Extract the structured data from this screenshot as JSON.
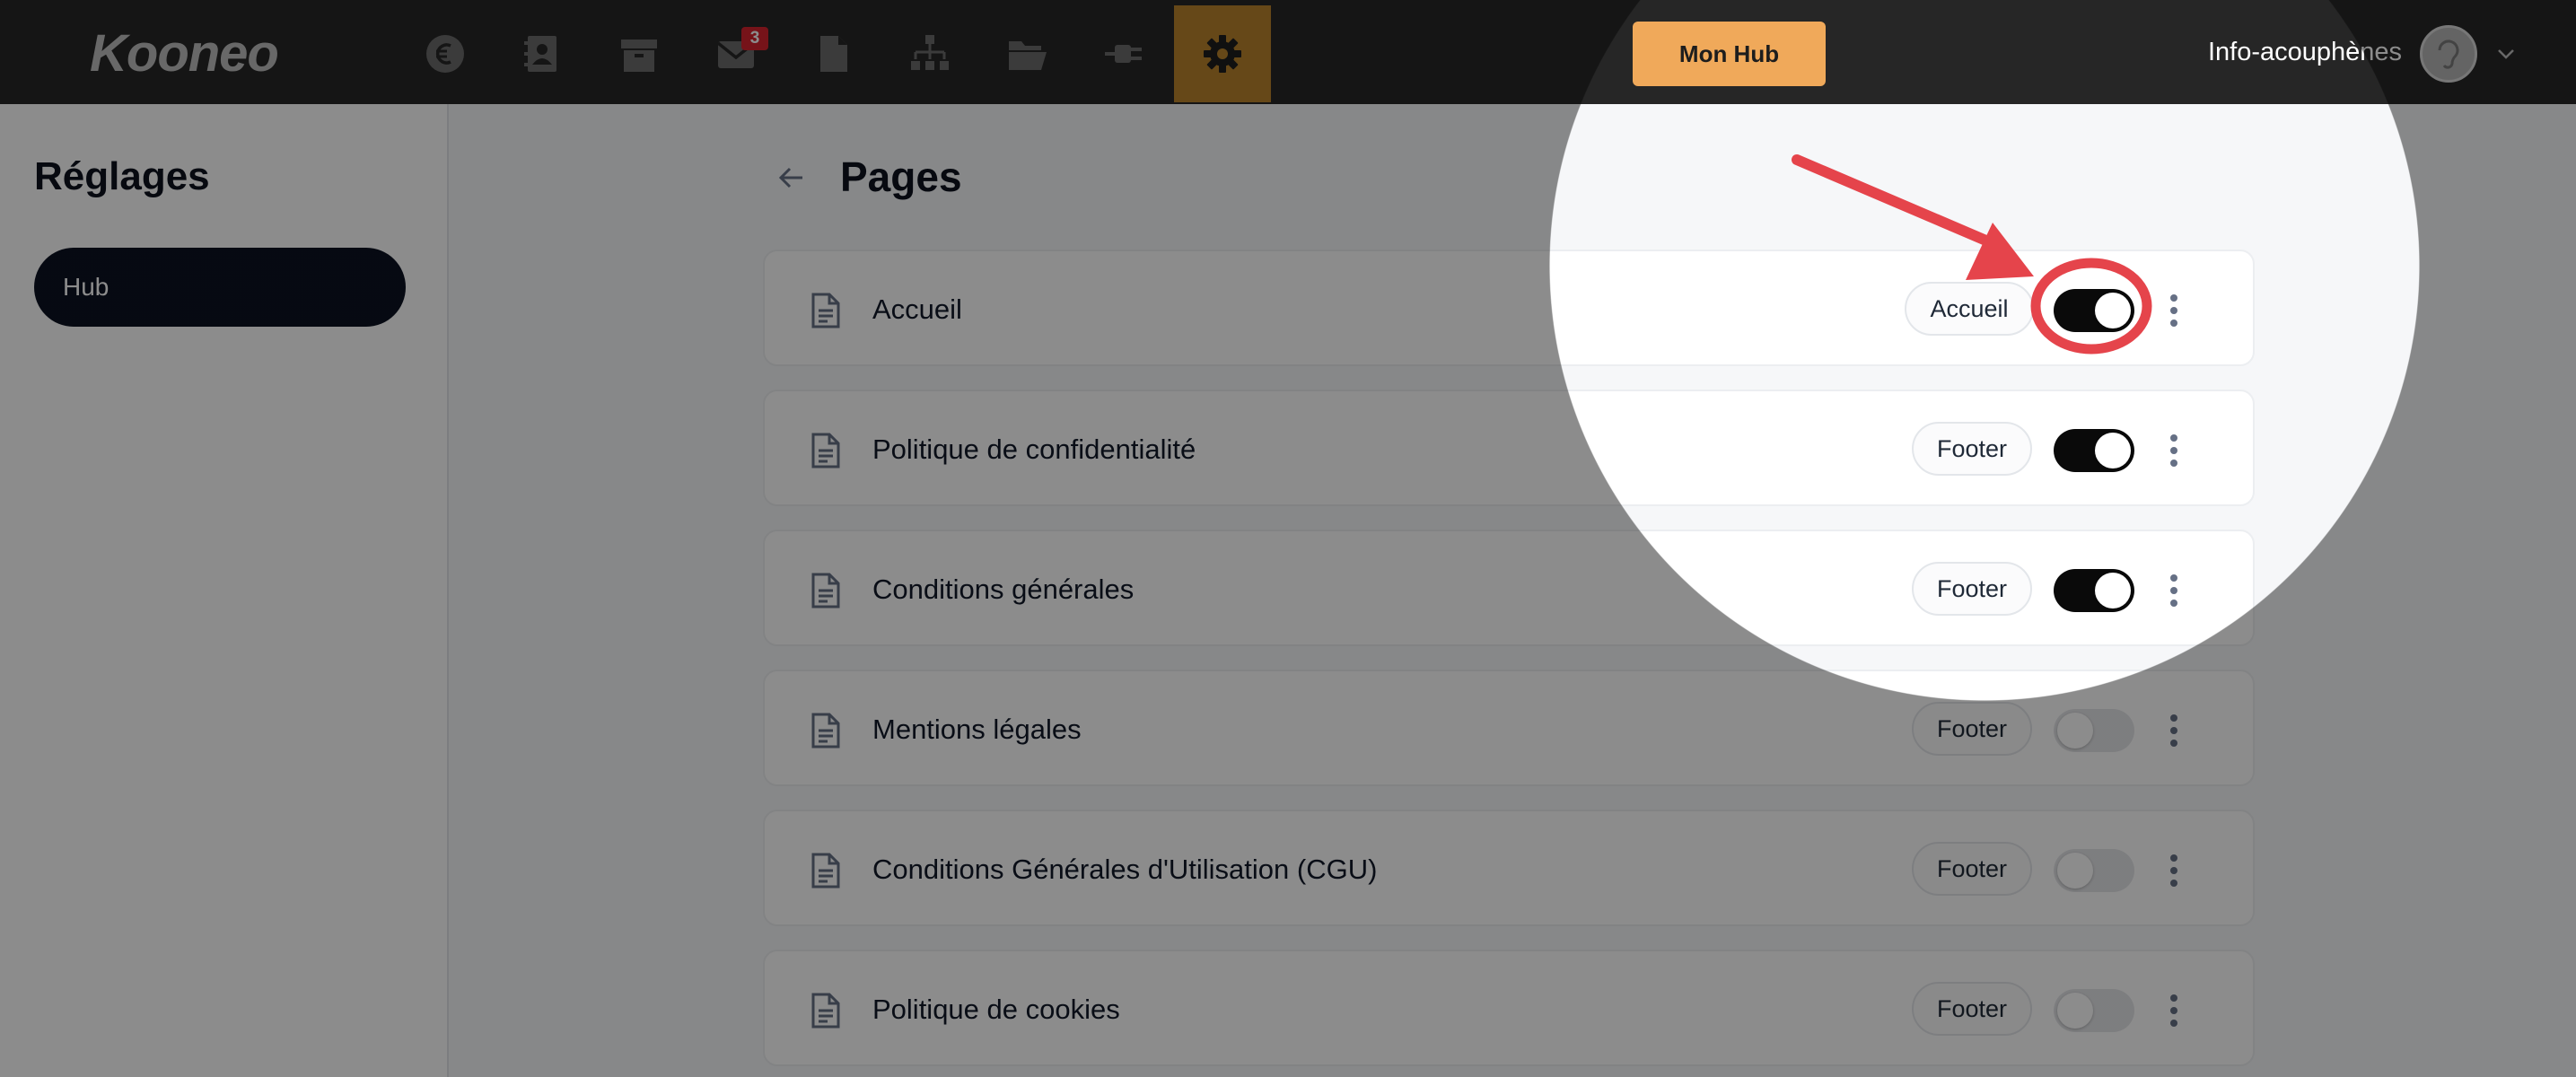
{
  "app": {
    "logo": "Kooneo",
    "nav_icons": [
      {
        "name": "euro-icon"
      },
      {
        "name": "contacts-icon"
      },
      {
        "name": "box-icon"
      },
      {
        "name": "mail-icon",
        "badge": "3"
      },
      {
        "name": "document-icon"
      },
      {
        "name": "sitemap-icon"
      },
      {
        "name": "folder-icon"
      },
      {
        "name": "plug-icon"
      },
      {
        "name": "gear-icon",
        "active": true
      }
    ],
    "hub_button": "Mon Hub",
    "user_name": "Info-acouphènes"
  },
  "sidebar": {
    "title": "Réglages",
    "items": [
      {
        "label": "Hub",
        "active": true
      }
    ]
  },
  "main": {
    "title": "Pages",
    "pages": [
      {
        "label": "Accueil",
        "tag": "Accueil",
        "enabled": true
      },
      {
        "label": "Politique de confidentialité",
        "tag": "Footer",
        "enabled": true
      },
      {
        "label": "Conditions générales",
        "tag": "Footer",
        "enabled": true
      },
      {
        "label": "Mentions légales",
        "tag": "Footer",
        "enabled": false
      },
      {
        "label": "Conditions Générales d'Utilisation (CGU)",
        "tag": "Footer",
        "enabled": false
      },
      {
        "label": "Politique de cookies",
        "tag": "Footer",
        "enabled": false
      }
    ]
  },
  "colors": {
    "topbar": "#262626",
    "active_nav": "#b9832b",
    "hub_button": "#f0a95a",
    "sidebar_active": "#0b1120",
    "toggle_on": "#0a0a0a",
    "toggle_off": "#e4e5e8",
    "annotation": "#e5444b",
    "badge": "#d6222e"
  }
}
